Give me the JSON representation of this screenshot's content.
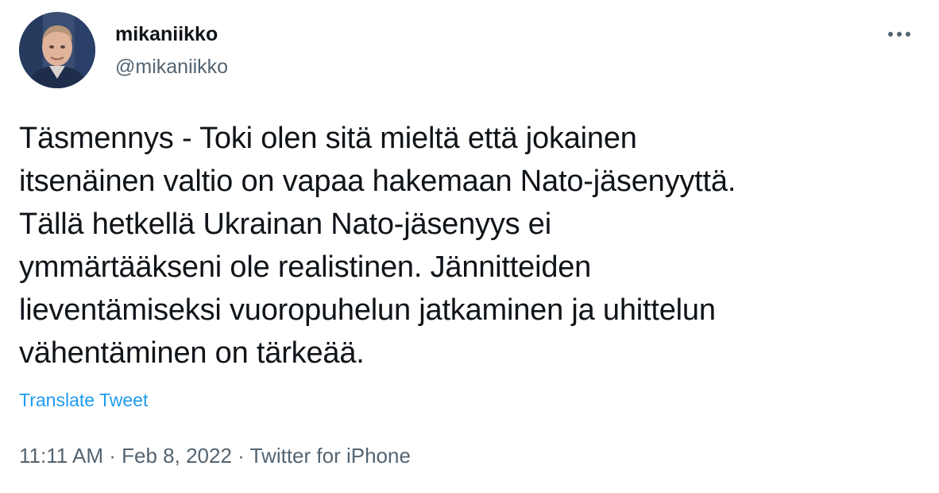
{
  "author": {
    "display_name": "mikaniikko",
    "handle": "@mikaniikko"
  },
  "icons": {
    "avatar": "profile-photo",
    "more": "more-options-icon"
  },
  "tweet": {
    "text": "Täsmennys - Toki olen sitä mieltä että jokainen\nitsenäinen valtio on vapaa hakemaan Nato-jäsenyyttä.\nTällä hetkellä Ukrainan Nato-jäsenyys ei\nymmärtääkseni ole realistinen. Jännitteiden\nlieventämiseksi vuoropuhelun jatkaminen ja uhittelun\nvähentäminen on tärkeää.",
    "translate_label": "Translate Tweet"
  },
  "meta": {
    "time": "11:11 AM",
    "separator": "·",
    "date": "Feb 8, 2022",
    "source": "Twitter for iPhone"
  },
  "colors": {
    "text": "#0f1419",
    "secondary": "#536471",
    "link": "#1d9bf0"
  }
}
